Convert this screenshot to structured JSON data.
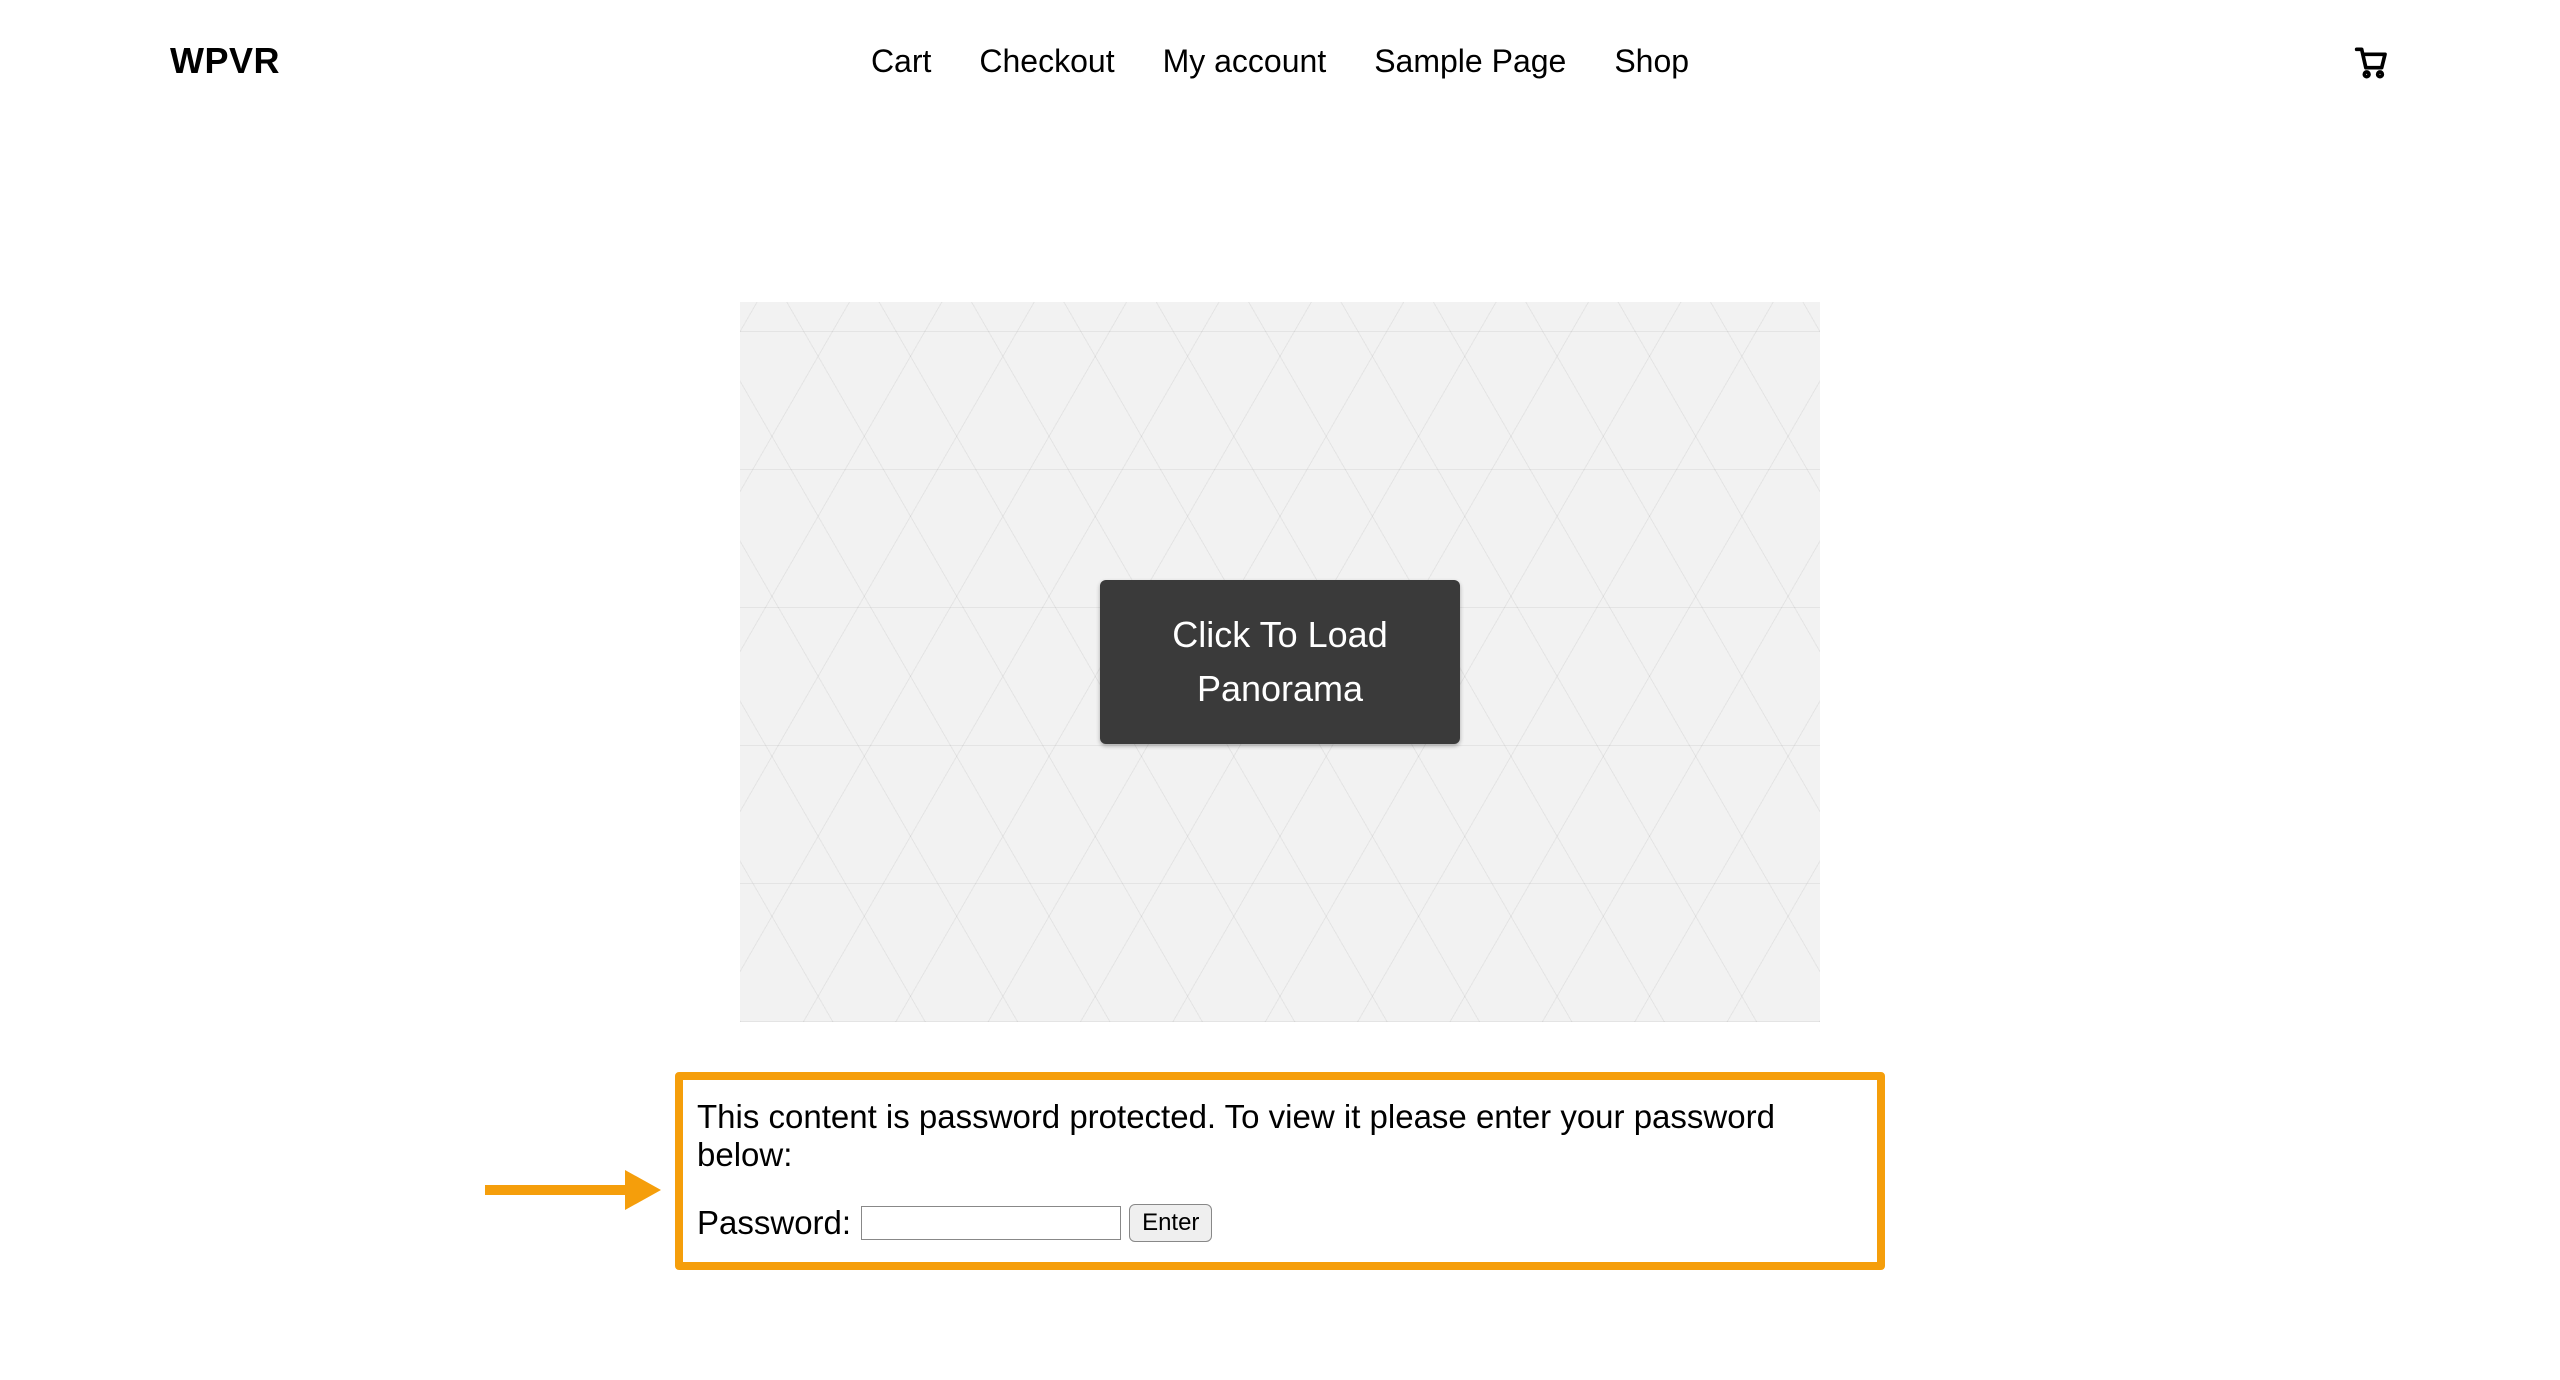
{
  "header": {
    "site_title": "WPVR",
    "nav": [
      {
        "label": "Cart"
      },
      {
        "label": "Checkout"
      },
      {
        "label": "My account"
      },
      {
        "label": "Sample Page"
      },
      {
        "label": "Shop"
      }
    ],
    "cart_icon": "cart-icon"
  },
  "panorama": {
    "load_button_label": "Click To Load Panorama"
  },
  "protected": {
    "message": "This content is password protected. To view it please enter your password below:",
    "password_label": "Password:",
    "password_value": "",
    "enter_label": "Enter"
  },
  "annotation": {
    "arrow_color": "#f59e0b",
    "highlight_color": "#f59e0b"
  }
}
